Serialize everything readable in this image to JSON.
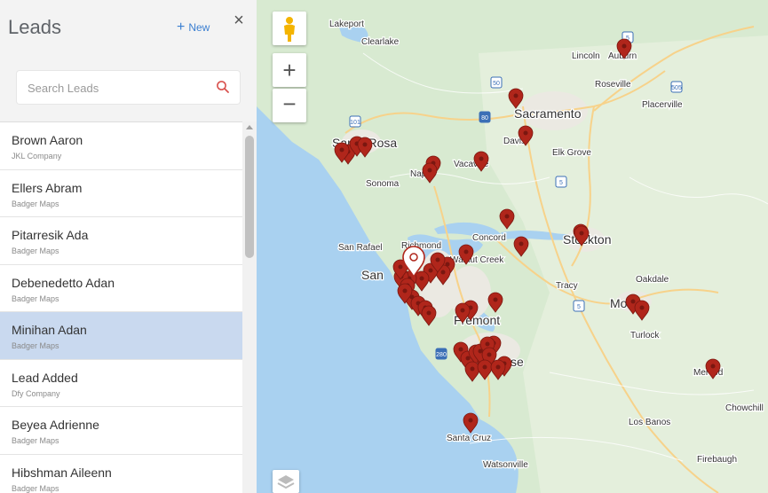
{
  "panel": {
    "title": "Leads",
    "new_label": "New",
    "close_label": "×",
    "search_placeholder": "Search Leads"
  },
  "leads": [
    {
      "name": "Brown Aaron",
      "company": "JKL Company",
      "selected": false
    },
    {
      "name": "Ellers Abram",
      "company": "Badger Maps",
      "selected": false
    },
    {
      "name": "Pitarresik Ada",
      "company": "Badger Maps",
      "selected": false
    },
    {
      "name": "Debenedetto Adan",
      "company": "Badger Maps",
      "selected": false
    },
    {
      "name": "Minihan Adan",
      "company": "Badger Maps",
      "selected": true
    },
    {
      "name": "Lead Added",
      "company": "Dfy Company",
      "selected": false
    },
    {
      "name": "Beyea Adrienne",
      "company": "Badger Maps",
      "selected": false
    },
    {
      "name": "Hibshman Aileenn",
      "company": "Badger Maps",
      "selected": false
    }
  ],
  "map": {
    "zoom_in_label": "+",
    "zoom_out_label": "−",
    "colors": {
      "water": "#a9d1f0",
      "land": "#d8ead1",
      "urban": "#e9e8e3",
      "pin": "#b0261b"
    },
    "cities": [
      {
        "name": "Lakeport",
        "size": "small"
      },
      {
        "name": "Clearlake",
        "size": "small"
      },
      {
        "name": "Lincoln",
        "size": "small"
      },
      {
        "name": "Auburn",
        "size": "small"
      },
      {
        "name": "Roseville",
        "size": "small"
      },
      {
        "name": "Sacramento",
        "size": "large"
      },
      {
        "name": "Placerville",
        "size": "small"
      },
      {
        "name": "Santa Rosa",
        "size": "large"
      },
      {
        "name": "Davis",
        "size": "small"
      },
      {
        "name": "Napa",
        "size": "small"
      },
      {
        "name": "Vacaville",
        "size": "small"
      },
      {
        "name": "Elk Grove",
        "size": "small"
      },
      {
        "name": "Sonoma",
        "size": "small"
      },
      {
        "name": "Concord",
        "size": "small"
      },
      {
        "name": "San Rafael",
        "size": "small"
      },
      {
        "name": "Richmond",
        "size": "small"
      },
      {
        "name": "Stockton",
        "size": "large"
      },
      {
        "name": "Walnut Creek",
        "size": "small"
      },
      {
        "name": "San",
        "size": "large"
      },
      {
        "name": "Tracy",
        "size": "small"
      },
      {
        "name": "Oakdale",
        "size": "small"
      },
      {
        "name": "Fremont",
        "size": "large"
      },
      {
        "name": "Mo",
        "size": "large"
      },
      {
        "name": "se",
        "size": "large"
      },
      {
        "name": "Turlock",
        "size": "small"
      },
      {
        "name": "Merced",
        "size": "small"
      },
      {
        "name": "Chowchill",
        "size": "small"
      },
      {
        "name": "Los Banos",
        "size": "small"
      },
      {
        "name": "Santa Cruz",
        "size": "small"
      },
      {
        "name": "Watsonville",
        "size": "small"
      },
      {
        "name": "Firebaugh",
        "size": "small"
      }
    ],
    "shields": [
      "5",
      "50",
      "505",
      "80",
      "101",
      "5",
      "5",
      "280"
    ],
    "pin_count": 48
  }
}
